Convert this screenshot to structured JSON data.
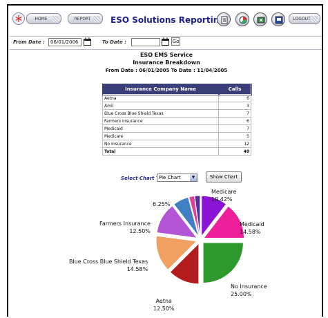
{
  "header": {
    "home_label": "HOME",
    "report_label": "REPORT",
    "title": "ESO Solutions Reporting",
    "logout_label": "LOGOUT"
  },
  "filters": {
    "from_label": "From Date :",
    "from_value": "06/01/2006",
    "to_label": "To Date :",
    "to_value": "",
    "go_label": "Go"
  },
  "report": {
    "line1": "ESO EMS Service",
    "line2": "Insurance Breakdown",
    "line3": "From Date : 06/01/2005 To Date : 11/04/2005"
  },
  "table": {
    "headers": [
      "Insurance Company Name",
      "Calls"
    ],
    "rows": [
      {
        "name": "Aetna",
        "calls": "6"
      },
      {
        "name": "Amil",
        "calls": "3"
      },
      {
        "name": "Blue Cross Blue Shield Texas",
        "calls": "7"
      },
      {
        "name": "Farmers Insurance",
        "calls": "6"
      },
      {
        "name": "Medicaid",
        "calls": "7"
      },
      {
        "name": "Medicare",
        "calls": "5"
      },
      {
        "name": "No Insurance",
        "calls": "12"
      }
    ],
    "total_label": "Total",
    "total_value": "48"
  },
  "chart_controls": {
    "type_label": "Select Chart Type :",
    "type_value": "Pie Chart",
    "show_label": "Show Chart"
  },
  "colors": {
    "brand_title": "#1b1f8a",
    "table_header": "#3a3f7a"
  },
  "icons": [
    "snowflake-icon",
    "help-icon",
    "chart-icon",
    "export-icon",
    "print-icon"
  ],
  "chart_data": {
    "type": "pie",
    "title": "",
    "slices": [
      {
        "label": "Medicare",
        "value": 10.42,
        "display": "Medicare\n10.42%",
        "color": "#8b13d6"
      },
      {
        "label": "Medicaid",
        "value": 14.58,
        "display": "Medicaid\n14.58%",
        "color": "#ee1f9a"
      },
      {
        "label": "No Insurance",
        "value": 25.0,
        "display": "No Insurance\n25.00%",
        "color": "#2e9a2e"
      },
      {
        "label": "Aetna",
        "value": 12.5,
        "display": "Aetna\n12.50%",
        "color": "#b31c1c"
      },
      {
        "label": "Blue Cross Blue Shield Texas",
        "value": 14.58,
        "display": "Blue Cross Blue Shield Texas\n14.58%",
        "color": "#f0a060"
      },
      {
        "label": "Farmers Insurance",
        "value": 12.5,
        "display": "Farmers Insurance\n12.50%",
        "color": "#b455d6"
      },
      {
        "label": "Amil",
        "value": 6.25,
        "display": "6.25%",
        "color": "#3f7fc2"
      },
      {
        "label": "",
        "value": 2.08,
        "display": "",
        "color": "#e0409a"
      },
      {
        "label": "",
        "value": 2.08,
        "display": "",
        "color": "#5a2aa0"
      }
    ]
  }
}
